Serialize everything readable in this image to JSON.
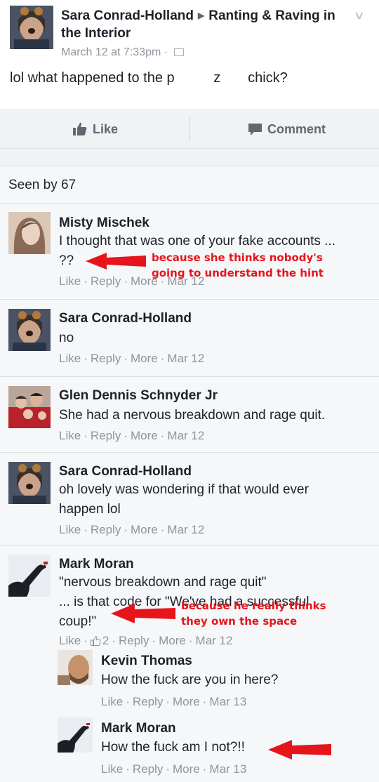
{
  "post": {
    "author": "Sara Conrad-Holland",
    "group": "Ranting & Raving in the Interior",
    "time": "March 12 at 7:33pm",
    "text": "lol what happened to the p          z       chick?"
  },
  "actions": {
    "like": "Like",
    "comment": "Comment"
  },
  "seen": "Seen by 67",
  "comments": [
    {
      "name": "Misty Mischek",
      "text": "I thought that was one of your fake accounts ...\n??",
      "like": "Like",
      "reply": "Reply",
      "more": "More",
      "date": "Mar 12"
    },
    {
      "name": "Sara Conrad-Holland",
      "text": "no",
      "like": "Like",
      "reply": "Reply",
      "more": "More",
      "date": "Mar 12"
    },
    {
      "name": "Glen Dennis Schnyder Jr",
      "text": "She had a nervous breakdown and rage quit.",
      "like": "Like",
      "reply": "Reply",
      "more": "More",
      "date": "Mar 12"
    },
    {
      "name": "Sara Conrad-Holland",
      "text": "oh lovely was wondering if that would ever\nhappen lol",
      "like": "Like",
      "reply": "Reply",
      "more": "More",
      "date": "Mar 12"
    },
    {
      "name": "Mark Moran",
      "text": "\"nervous breakdown and rage quit\"\n... is that code for \"We've had a successful\ncoup!\"",
      "like": "Like",
      "reactions": "2",
      "reply": "Reply",
      "more": "More",
      "date": "Mar 12"
    }
  ],
  "replies": [
    {
      "name": "Kevin Thomas",
      "text": "How the fuck are you in here?",
      "like": "Like",
      "reply": "Reply",
      "more": "More",
      "date": "Mar 13"
    },
    {
      "name": "Mark Moran",
      "text": "How the fuck am I not?!!",
      "like": "Like",
      "reply": "Reply",
      "more": "More",
      "date": "Mar 13"
    }
  ],
  "annotations": {
    "first": "because she thinks nobody's\ngoing to understand the hint",
    "second": "because he really thinks\nthey own the space"
  },
  "colors": {
    "annotation": "#e5151b",
    "meta": "#90949c",
    "action": "#606770"
  }
}
